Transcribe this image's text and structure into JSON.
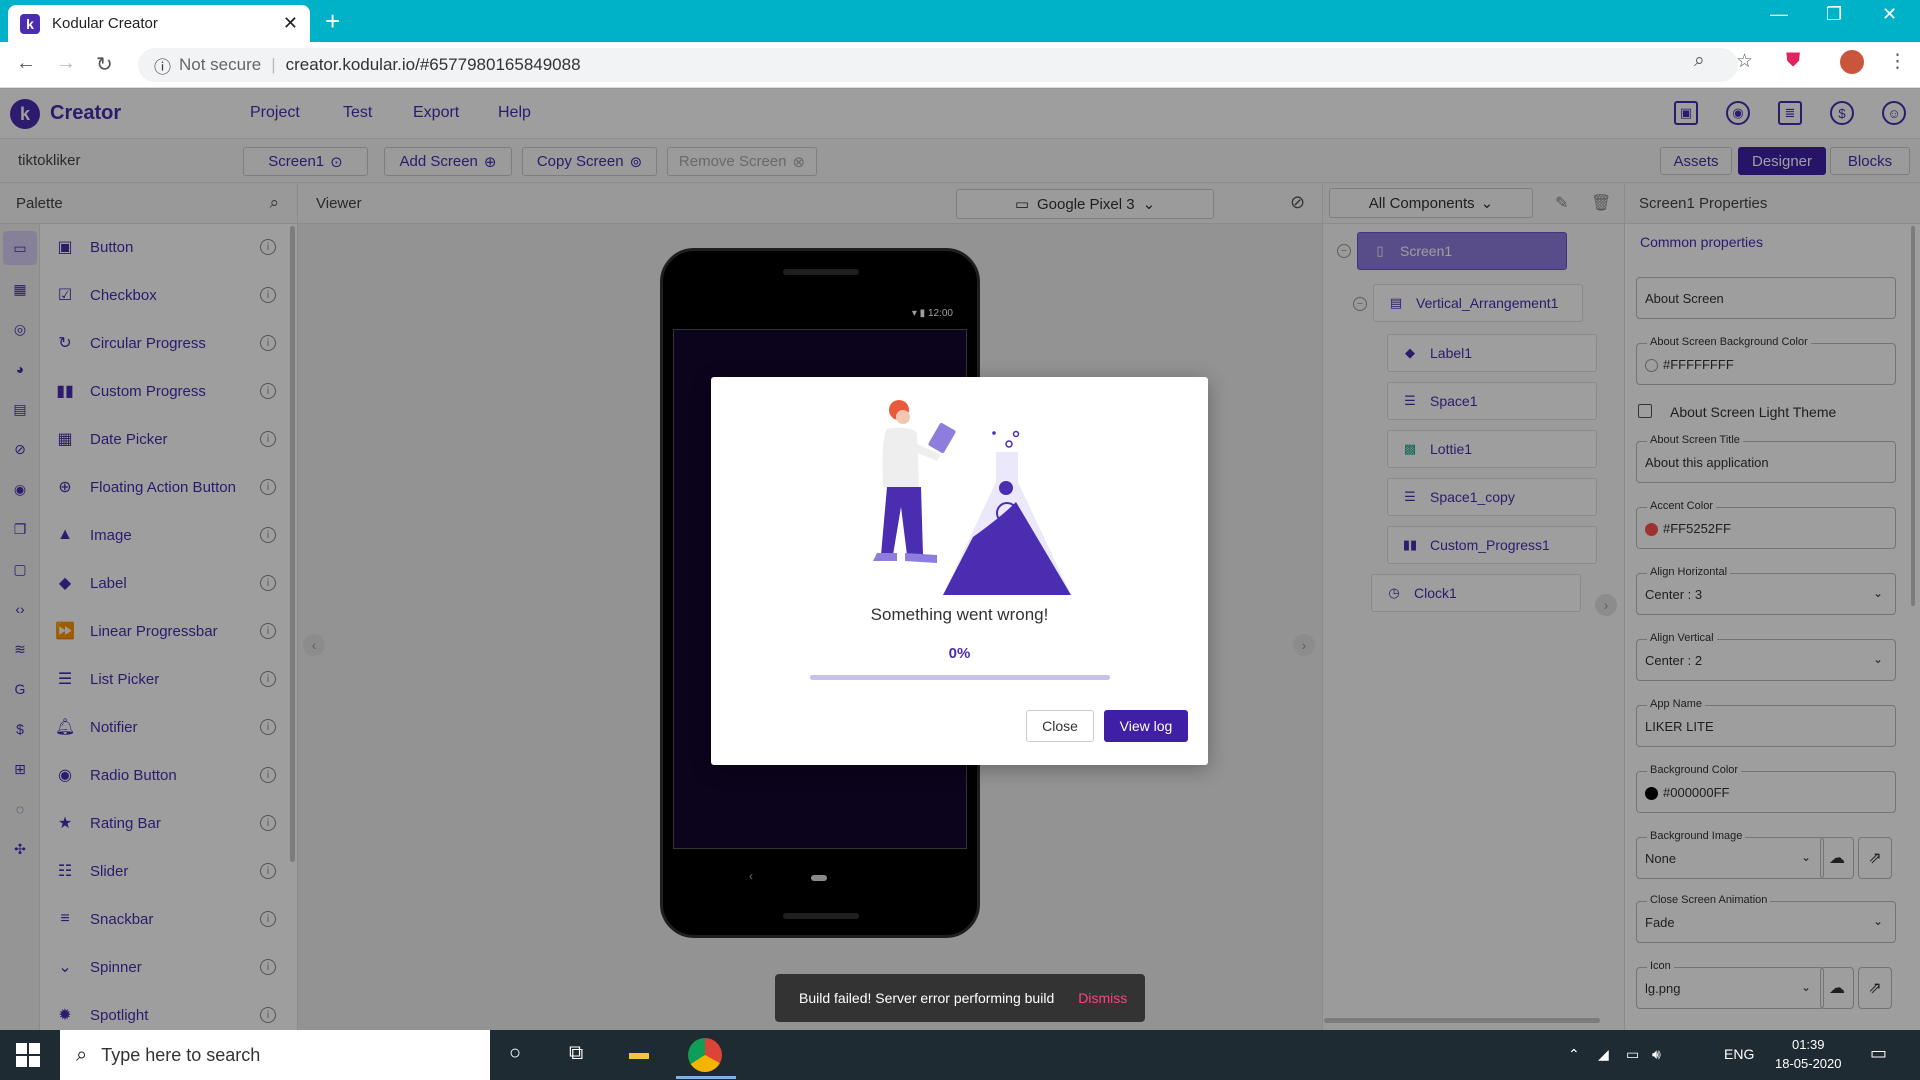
{
  "browser": {
    "tab_title": "Kodular Creator",
    "security": "Not secure",
    "url": "creator.kodular.io/#6577980165849088"
  },
  "app": {
    "brand": "Creator",
    "menu": [
      "Project",
      "Test",
      "Export",
      "Help"
    ]
  },
  "toolbar": {
    "project_name": "tiktokliker",
    "screen_select": "Screen1",
    "add_screen": "Add Screen",
    "copy_screen": "Copy Screen",
    "remove_screen": "Remove Screen",
    "assets": "Assets",
    "designer": "Designer",
    "blocks": "Blocks"
  },
  "palette": {
    "title": "Palette",
    "items": [
      {
        "label": "Button",
        "icon": "button-icon"
      },
      {
        "label": "Checkbox",
        "icon": "checkbox-icon"
      },
      {
        "label": "Circular Progress",
        "icon": "circular-progress-icon"
      },
      {
        "label": "Custom Progress",
        "icon": "bars-icon"
      },
      {
        "label": "Date Picker",
        "icon": "calendar-icon"
      },
      {
        "label": "Floating Action Button",
        "icon": "plus-circle-icon"
      },
      {
        "label": "Image",
        "icon": "image-icon"
      },
      {
        "label": "Label",
        "icon": "label-icon"
      },
      {
        "label": "Linear Progressbar",
        "icon": "fast-forward-icon"
      },
      {
        "label": "List Picker",
        "icon": "list-icon"
      },
      {
        "label": "Notifier",
        "icon": "bell-icon"
      },
      {
        "label": "Radio Button",
        "icon": "radio-icon"
      },
      {
        "label": "Rating Bar",
        "icon": "star-icon"
      },
      {
        "label": "Slider",
        "icon": "slider-icon"
      },
      {
        "label": "Snackbar",
        "icon": "snackbar-icon"
      },
      {
        "label": "Spinner",
        "icon": "dropdown-circle-icon"
      },
      {
        "label": "Spotlight",
        "icon": "spotlight-icon"
      }
    ]
  },
  "viewer": {
    "title": "Viewer",
    "device": "Google Pixel 3",
    "status_time": "12:00"
  },
  "components": {
    "filter": "All Components",
    "tree": [
      "Screen1",
      "Vertical_Arrangement1",
      "Label1",
      "Space1",
      "Lottie1",
      "Space1_copy",
      "Custom_Progress1",
      "Clock1"
    ]
  },
  "properties": {
    "title": "Screen1 Properties",
    "tab": "Common properties",
    "about_screen_placeholder": "About Screen",
    "fields": {
      "bg_color_label": "About Screen Background Color",
      "bg_color_value": "#FFFFFFFF",
      "light_theme_label": "About Screen Light Theme",
      "title_label": "About Screen Title",
      "title_value": "About this application",
      "accent_label": "Accent Color",
      "accent_value": "#FF5252FF",
      "align_h_label": "Align Horizontal",
      "align_h_value": "Center : 3",
      "align_v_label": "Align Vertical",
      "align_v_value": "Center : 2",
      "app_name_label": "App Name",
      "app_name_value": "LIKER LITE",
      "background_color_label": "Background Color",
      "background_color_value": "#000000FF",
      "background_image_label": "Background Image",
      "background_image_value": "None",
      "close_anim_label": "Close Screen Animation",
      "close_anim_value": "Fade",
      "icon_label": "Icon",
      "icon_value": "lg.png"
    },
    "colors": {
      "white": "#FFFFFF",
      "accent": "#FF5252",
      "black": "#000000"
    }
  },
  "dialog": {
    "message": "Something went wrong!",
    "progress_text": "0%",
    "progress": 0,
    "close": "Close",
    "view_log": "View log"
  },
  "snackbar": {
    "message": "Build failed! Server error performing build",
    "action": "Dismiss"
  },
  "taskbar": {
    "search_placeholder": "Type here to search",
    "lang": "ENG",
    "time": "01:39",
    "date": "18-05-2020"
  },
  "colors": {
    "brand": "#4A2DB0",
    "browser_tab_bar": "#00B2C7",
    "snackbar_action": "#FF4081"
  }
}
